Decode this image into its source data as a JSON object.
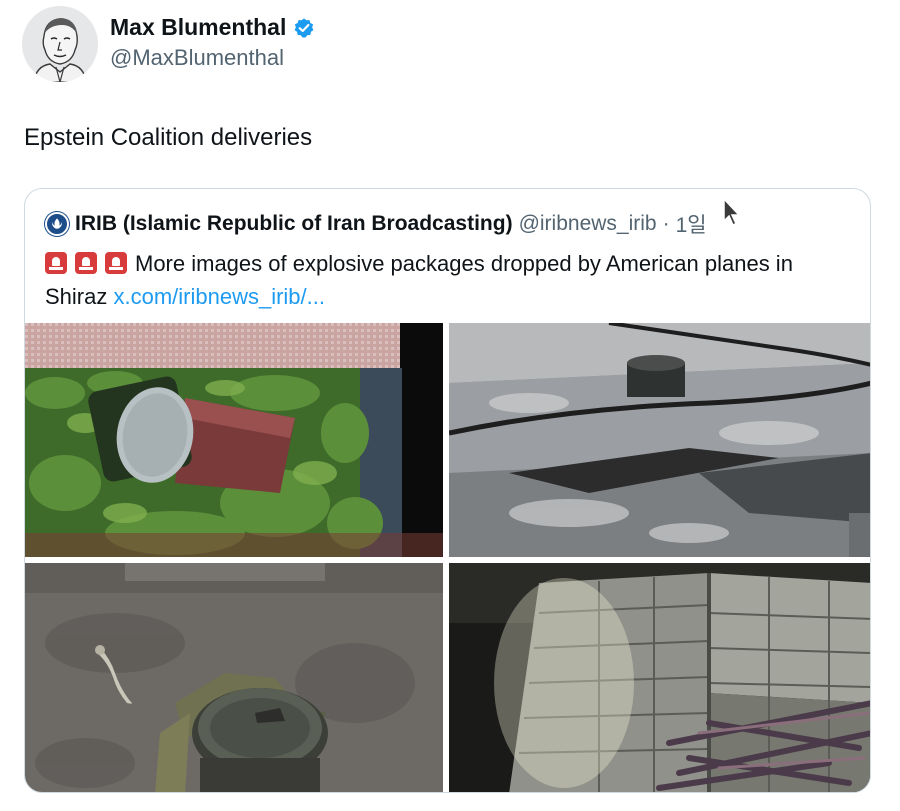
{
  "author": {
    "name": "Max Blumenthal",
    "handle": "@MaxBlumenthal",
    "verified": true,
    "avatar_icon": "portrait-sketch-avatar"
  },
  "tweet": {
    "text": "Epstein Coalition deliveries"
  },
  "quoted": {
    "name": "IRIB (Islamic Republic of Iran Broadcasting)",
    "handle": "@iribnews_irib",
    "separator": "·",
    "time": "1일",
    "emoji_icons": [
      "siren-icon",
      "siren-icon",
      "siren-icon"
    ],
    "text": "More images of explosive packages dropped by American planes in Shiraz",
    "link": "x.com/iribnews_irib/...",
    "images": [
      {
        "name": "canister-in-plants-image"
      },
      {
        "name": "canister-on-concrete-image"
      },
      {
        "name": "damaged-canister-on-ground-image"
      },
      {
        "name": "brick-corner-with-debris-image"
      }
    ]
  },
  "colors": {
    "text_primary": "#0f1419",
    "text_secondary": "#536471",
    "link": "#1d9bf0",
    "verified": "#1d9bf0",
    "border": "#cfd9de"
  }
}
